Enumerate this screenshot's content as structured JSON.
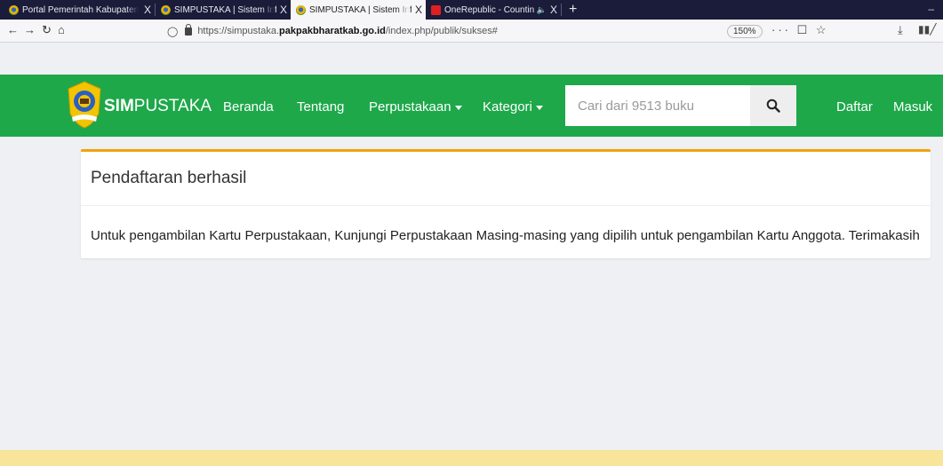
{
  "browser": {
    "tabs": [
      {
        "title": "Portal Pemerintah Kabupaten Pa",
        "active": false
      },
      {
        "title": "SIMPUSTAKA | Sistem Informasi",
        "active": false
      },
      {
        "title": "SIMPUSTAKA | Sistem Informasi",
        "active": true
      },
      {
        "title": "OneRepublic - Counting Sta",
        "active": false
      }
    ],
    "close_glyph": "X",
    "new_tab_glyph": "+",
    "url_prefix": "https://simpustaka.",
    "url_domain": "pakpakbharatkab.go.id",
    "url_path": "/index.php/publik/sukses#",
    "zoom": "150%",
    "page_actions": "··· ☐ ☆"
  },
  "site": {
    "brand_bold": "SIM",
    "brand_rest": "PUSTAKA",
    "nav": {
      "beranda": "Beranda",
      "tentang": "Tentang",
      "perpustakaan": "Perpustakaan",
      "kategori": "Kategori",
      "daftar": "Daftar",
      "masuk": "Masuk"
    },
    "search_placeholder": "Cari dari 9513 buku"
  },
  "content": {
    "title": "Pendaftaran berhasil",
    "message": "Untuk pengambilan Kartu Perpustakaan, Kunjungi Perpustakaan Masing-masing yang dipilih untuk pengambilan Kartu Anggota. Terimakasih"
  },
  "colors": {
    "header_green": "#1ea84a",
    "card_accent": "#f0a30a",
    "page_bg": "#eef0f4",
    "frame": "#f8e59a"
  }
}
